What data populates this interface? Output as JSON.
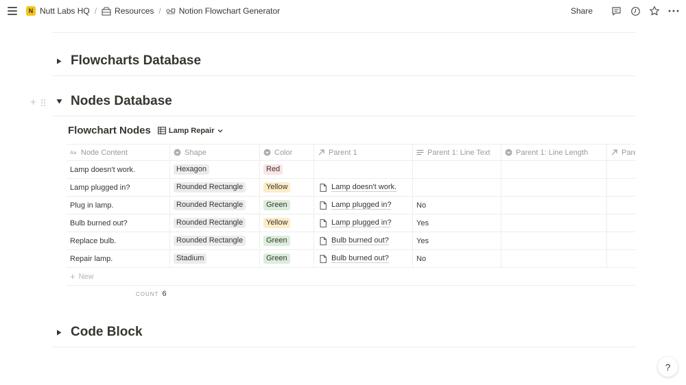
{
  "breadcrumbs": [
    {
      "label": "Nutt Labs HQ",
      "icon": "notion-logo-icon"
    },
    {
      "label": "Resources",
      "icon": "shelf-icon"
    },
    {
      "label": "Notion Flowchart Generator",
      "icon": "flowchart-icon"
    }
  ],
  "logo_letter": "N",
  "separator": "/",
  "topbar": {
    "share_label": "Share"
  },
  "sections": {
    "flowcharts": "Flowcharts Database",
    "nodes": "Nodes Database",
    "code": "Code Block"
  },
  "database": {
    "title": "Flowchart Nodes",
    "view_label": "Lamp Repair",
    "columns": [
      "Node Content",
      "Shape",
      "Color",
      "Parent 1",
      "Parent 1: Line Text",
      "Parent 1: Line Length",
      "Pare"
    ],
    "rows": [
      {
        "content": "Lamp doesn't work.",
        "shape": "Hexagon",
        "color": "Red",
        "parent": "",
        "line_text": ""
      },
      {
        "content": "Lamp plugged in?",
        "shape": "Rounded Rectangle",
        "color": "Yellow",
        "parent": "Lamp doesn't work.",
        "line_text": ""
      },
      {
        "content": "Plug in lamp.",
        "shape": "Rounded Rectangle",
        "color": "Green",
        "parent": "Lamp plugged in?",
        "line_text": "No"
      },
      {
        "content": "Bulb burned out?",
        "shape": "Rounded Rectangle",
        "color": "Yellow",
        "parent": "Lamp plugged in?",
        "line_text": "Yes"
      },
      {
        "content": "Replace bulb.",
        "shape": "Rounded Rectangle",
        "color": "Green",
        "parent": "Bulb burned out?",
        "line_text": "Yes"
      },
      {
        "content": "Repair lamp.",
        "shape": "Stadium",
        "color": "Green",
        "parent": "Bulb burned out?",
        "line_text": "No"
      }
    ],
    "new_label": "New",
    "count_label": "COUNT",
    "count_value": "6"
  },
  "colors": {
    "Red": "#fbe4e4",
    "Yellow": "#fdecc8",
    "Green": "#dbeddb",
    "tag_gray": "#ebeced",
    "logo": "#f5c518"
  },
  "help_label": "?"
}
